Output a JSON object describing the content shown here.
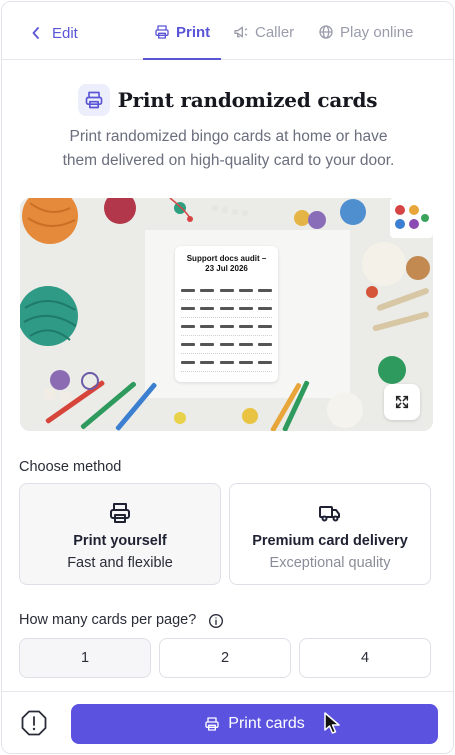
{
  "nav": {
    "back_label": "Edit",
    "tabs": [
      {
        "label": "Print",
        "icon": "printer-icon",
        "active": true
      },
      {
        "label": "Caller",
        "icon": "megaphone-icon",
        "active": false
      },
      {
        "label": "Play online",
        "icon": "globe-icon",
        "active": false
      }
    ]
  },
  "header": {
    "title": "Print randomized cards",
    "subtitle_line1": "Print randomized bingo cards at home or have",
    "subtitle_line2": "them delivered on high-quality card to your door."
  },
  "preview": {
    "card_title_line1": "Support docs audit –",
    "card_title_line2": "23 Jul 2026",
    "expand_icon": "expand-icon"
  },
  "method": {
    "label": "Choose method",
    "options": [
      {
        "title": "Print yourself",
        "subtitle": "Fast and flexible",
        "icon": "printer-icon",
        "selected": true
      },
      {
        "title": "Premium card delivery",
        "subtitle": "Exceptional quality",
        "icon": "truck-icon",
        "selected": false
      }
    ]
  },
  "cards_per_page": {
    "label": "How many cards per page?",
    "options": [
      "1",
      "2",
      "4"
    ],
    "selected": "1"
  },
  "footer": {
    "report_icon": "alert-octagon-icon",
    "print_label": "Print cards"
  },
  "colors": {
    "accent": "#5b53e0",
    "accent_text": "#5a55d6",
    "border": "#dfe0e7"
  }
}
